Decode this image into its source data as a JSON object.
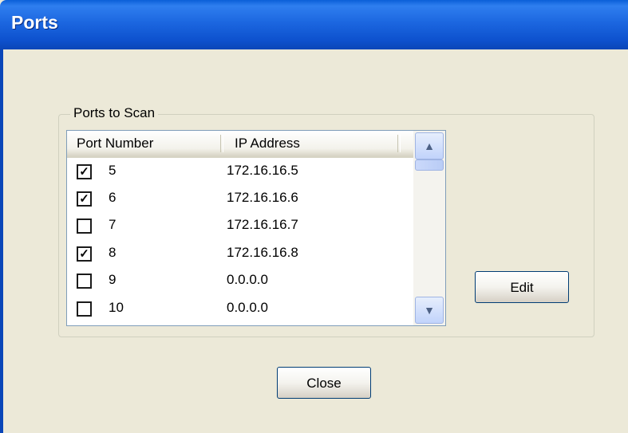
{
  "window": {
    "title": "Ports"
  },
  "group": {
    "label": "Ports to Scan"
  },
  "list": {
    "columns": [
      "Port Number",
      "IP Address"
    ],
    "rows": [
      {
        "checked": true,
        "port": "5",
        "ip": "172.16.16.5"
      },
      {
        "checked": true,
        "port": "6",
        "ip": "172.16.16.6"
      },
      {
        "checked": false,
        "port": "7",
        "ip": "172.16.16.7"
      },
      {
        "checked": true,
        "port": "8",
        "ip": "172.16.16.8"
      },
      {
        "checked": false,
        "port": "9",
        "ip": "0.0.0.0"
      },
      {
        "checked": false,
        "port": "10",
        "ip": "0.0.0.0"
      }
    ]
  },
  "buttons": {
    "edit": "Edit",
    "close": "Close"
  },
  "colors": {
    "title_bar": "#0A5FD8",
    "dialog_bg": "#ECE9D8"
  }
}
